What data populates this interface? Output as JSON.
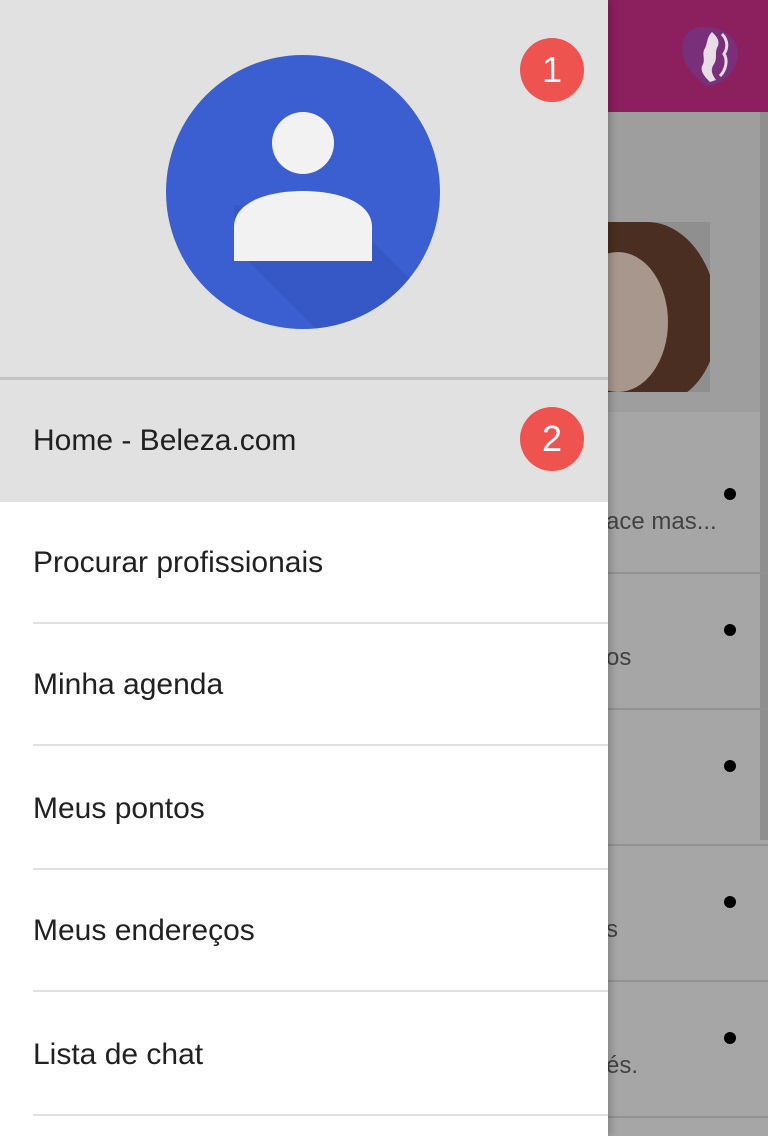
{
  "background": {
    "app_bar_color": "#8c1f5e",
    "logo_icon": "woman-profile-logo-icon",
    "list_rows": [
      {
        "text": "ace mas..."
      },
      {
        "text": "os"
      },
      {
        "text": ""
      },
      {
        "text": "s"
      },
      {
        "text": "és."
      }
    ]
  },
  "drawer": {
    "header": {
      "avatar_icon": "contact-avatar-icon",
      "notification_badge": "1"
    },
    "menu": [
      {
        "label": "Home - Beleza.com",
        "badge": "2",
        "selected": true
      },
      {
        "label": "Procurar profissionais"
      },
      {
        "label": "Minha agenda"
      },
      {
        "label": "Meus pontos"
      },
      {
        "label": "Meus endereços"
      },
      {
        "label": "Lista de chat"
      }
    ],
    "colors": {
      "badge": "#ef5350",
      "header_bg": "#e1e1e1",
      "avatar_blue": "#3b5fd0"
    }
  }
}
